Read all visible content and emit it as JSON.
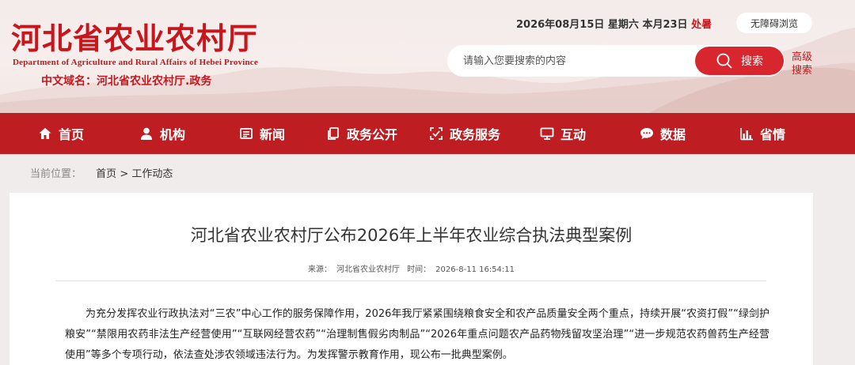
{
  "header": {
    "logo_cn": "河北省农业农村厅",
    "logo_en": "Department of Agriculture and Rural Affairs of Hebei Province",
    "domain_label": "中文域名：河北省农业农村厅.政务",
    "date": "2026年08月15日",
    "weekday": "星期六",
    "lunar": "本月23日",
    "solar_term": "处暑",
    "accessibility_label": "无障碍浏览",
    "search_placeholder": "请输入您要搜索的内容",
    "search_button": "搜索",
    "advanced_search": "高级搜索"
  },
  "nav": {
    "items": [
      {
        "label": "首页",
        "icon": "home-icon"
      },
      {
        "label": "机构",
        "icon": "user-icon"
      },
      {
        "label": "新闻",
        "icon": "news-icon"
      },
      {
        "label": "政务公开",
        "icon": "document-icon"
      },
      {
        "label": "政务服务",
        "icon": "service-icon"
      },
      {
        "label": "互动",
        "icon": "monitor-icon"
      },
      {
        "label": "数据",
        "icon": "chat-icon"
      },
      {
        "label": "省情",
        "icon": "bar-chart-icon"
      }
    ]
  },
  "breadcrumb": {
    "label": "当前位置：",
    "home": "首页",
    "separator": ">",
    "current": "工作动态"
  },
  "article": {
    "title": "河北省农业农村厅公布2026年上半年农业综合执法典型案例",
    "source_label": "来源：",
    "source": "河北省农业农村厅",
    "time_label": "时间：",
    "time": "2026-8-11 16:54:11",
    "paragraph": "为充分发挥农业行政执法对“三农”中心工作的服务保障作用，2026年我厅紧紧围绕粮食安全和农产品质量安全两个重点，持续开展“农资打假”“绿剑护粮安”“禁限用农药非法生产经营使用”“互联网经营农药”“治理制售假劣肉制品”“2026年重点问题农产品药物残留攻坚治理”“进一步规范农药兽药生产经营使用”等多个专项行动，依法查处涉农领域违法行为。为发挥警示教育作用，现公布一批典型案例。"
  },
  "colors": {
    "brand_red": "#c8161d",
    "nav_red": "#be1d22",
    "search_red": "#d7262e"
  }
}
